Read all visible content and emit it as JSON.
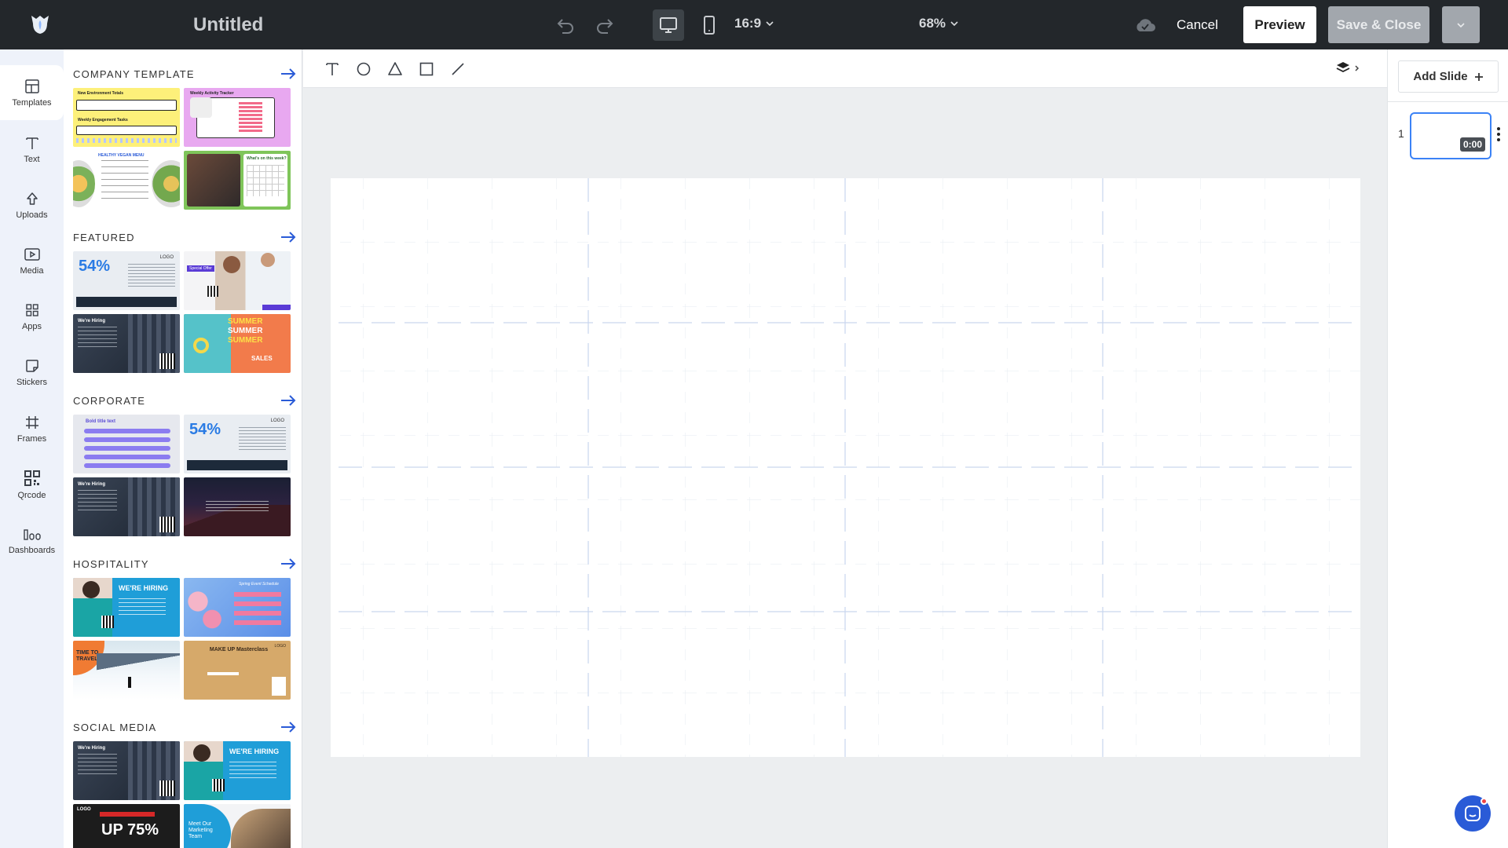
{
  "app": {
    "title": "Untitled"
  },
  "toolbar": {
    "aspect_ratio": "16:9",
    "zoom": "68%",
    "cancel_label": "Cancel",
    "preview_label": "Preview",
    "save_close_label": "Save & Close"
  },
  "rail": {
    "items": [
      {
        "label": "Templates",
        "icon": "templates-icon"
      },
      {
        "label": "Text",
        "icon": "text-icon"
      },
      {
        "label": "Uploads",
        "icon": "upload-icon"
      },
      {
        "label": "Media",
        "icon": "media-icon"
      },
      {
        "label": "Apps",
        "icon": "apps-icon"
      },
      {
        "label": "Stickers",
        "icon": "sticker-icon"
      },
      {
        "label": "Frames",
        "icon": "frame-icon"
      },
      {
        "label": "Qrcode",
        "icon": "qrcode-icon"
      },
      {
        "label": "Dashboards",
        "icon": "dashboard-icon"
      }
    ]
  },
  "panel": {
    "sections": [
      {
        "title": "COMPANY TEMPLATE"
      },
      {
        "title": "FEATURED"
      },
      {
        "title": "CORPORATE"
      },
      {
        "title": "HOSPITALITY"
      },
      {
        "title": "SOCIAL MEDIA"
      }
    ]
  },
  "thumbs": {
    "company": [
      "New Environment Totals",
      "Weekly Engagement Tasks",
      "Weekly Activity Tracker",
      "HEALTHY VEGAN MENU",
      "What's on this week?"
    ],
    "featured": [
      "54%",
      "LOGO",
      "Special Offer",
      "We're Hiring",
      "SUMMER",
      "SALES"
    ],
    "corporate": [
      "Bold title text",
      "54%",
      "LOGO",
      "We're Hiring"
    ],
    "hospitality": [
      "WE'RE HIRING",
      "Spring Event Schedule",
      "TIME TO TRAVEL",
      "MAKE UP Masterclass",
      "LOGO"
    ],
    "social": [
      "We're Hiring",
      "WE'RE HIRING",
      "LOGO",
      "UP 75%",
      "Meet Our Marketing Team"
    ]
  },
  "right_panel": {
    "add_slide_label": "Add Slide",
    "slide_number": "1",
    "slide_duration": "0:00"
  },
  "colors": {
    "topbar": "#23272b",
    "accent_blue": "#3b82f6",
    "rail_bg": "#eef2fa"
  }
}
